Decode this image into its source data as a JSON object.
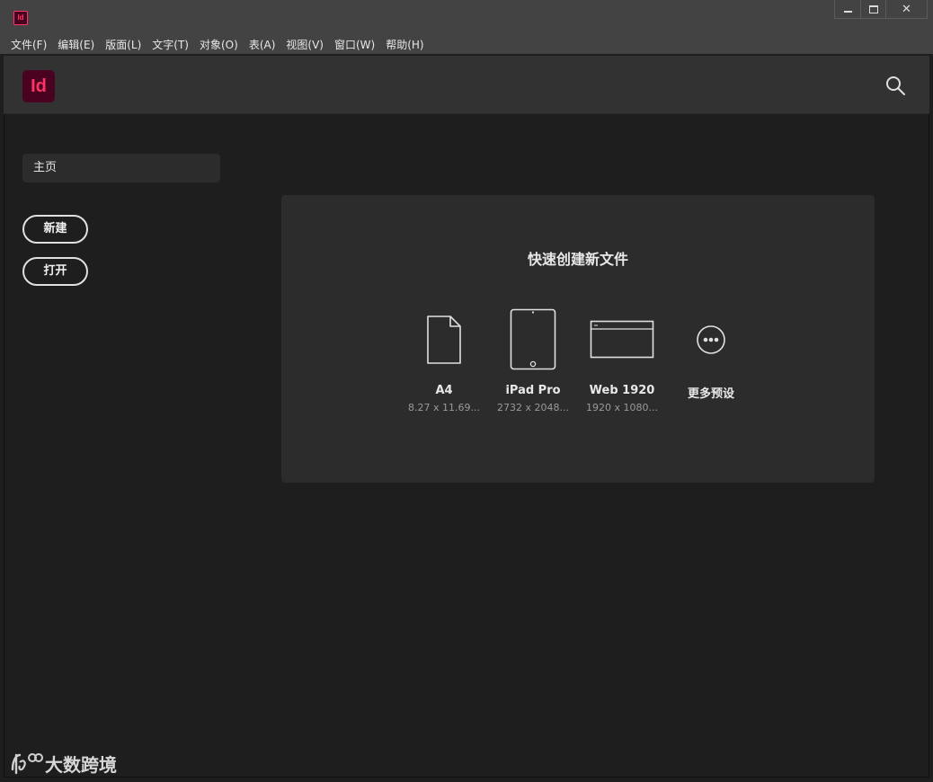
{
  "titlebar": {
    "app_icon_text": "Id",
    "controls": [
      "minimize",
      "maximize",
      "close"
    ],
    "close_glyph": "✕"
  },
  "menu": [
    {
      "label": "文件(F)"
    },
    {
      "label": "编辑(E)"
    },
    {
      "label": "版面(L)"
    },
    {
      "label": "文字(T)"
    },
    {
      "label": "对象(O)"
    },
    {
      "label": "表(A)"
    },
    {
      "label": "视图(V)"
    },
    {
      "label": "窗口(W)"
    },
    {
      "label": "帮助(H)"
    }
  ],
  "header": {
    "logo_text": "Id",
    "search_icon": "search-icon"
  },
  "sidebar": {
    "home_label": "主页",
    "new_label": "新建",
    "open_label": "打开"
  },
  "quick_create": {
    "title": "快速创建新文件",
    "presets": [
      {
        "name": "A4",
        "dims": "8.27 x 11.69...",
        "icon": "document-icon"
      },
      {
        "name": "iPad Pro",
        "dims": "2732 x 2048...",
        "icon": "tablet-icon"
      },
      {
        "name": "Web 1920",
        "dims": "1920 x 1080...",
        "icon": "browser-window-icon"
      },
      {
        "name": "更多预设",
        "dims": "",
        "icon": "more-icon"
      }
    ]
  },
  "watermark": {
    "text": "大数跨境"
  },
  "colors": {
    "accent": "#ff3366",
    "logo_bg": "#49021f",
    "background": "#1e1e1e",
    "panel": "#2c2c2c",
    "header": "#323232",
    "chrome": "#434343"
  }
}
